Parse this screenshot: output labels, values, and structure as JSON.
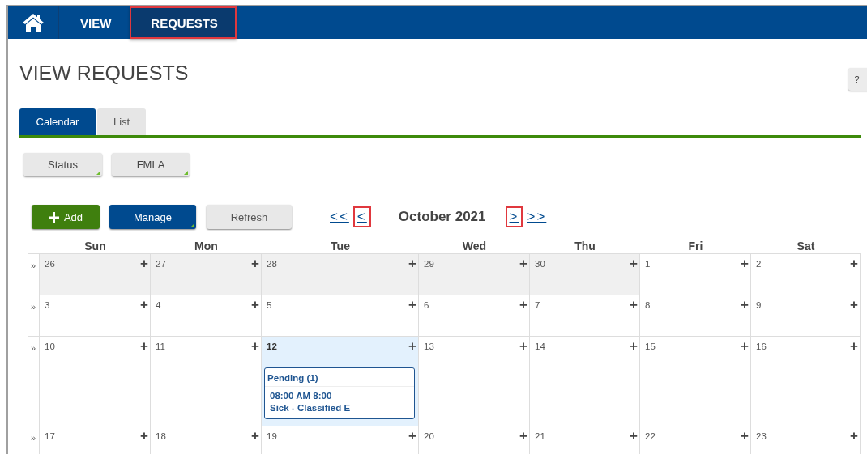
{
  "nav": {
    "items": [
      {
        "label": "VIEW",
        "selected": false,
        "highlighted": false
      },
      {
        "label": "REQUESTS",
        "selected": true,
        "highlighted": true
      }
    ]
  },
  "help": {
    "label": "?"
  },
  "page_title": "VIEW REQUESTS",
  "tabs": [
    {
      "label": "Calendar",
      "selected": true
    },
    {
      "label": "List",
      "selected": false
    }
  ],
  "filters": [
    "Status",
    "FMLA"
  ],
  "toolbar": {
    "add": "Add",
    "manage": "Manage",
    "refresh": "Refresh"
  },
  "month_nav": {
    "items": [
      {
        "label": "<<",
        "highlighted": false
      },
      {
        "label": "<",
        "highlighted": true
      },
      {
        "label": "October 2021",
        "kind": "title"
      },
      {
        "label": ">",
        "highlighted": true
      },
      {
        "label": ">>",
        "highlighted": false
      }
    ]
  },
  "calendar": {
    "expand_label": "»",
    "add_label": "+",
    "weekdays": [
      "Sun",
      "Mon",
      "Tue",
      "Wed",
      "Thu",
      "Fri",
      "Sat"
    ],
    "weeks": [
      {
        "days": [
          {
            "day": "26",
            "out_of_month": true,
            "selected": false
          },
          {
            "day": "27",
            "out_of_month": true,
            "selected": false
          },
          {
            "day": "28",
            "out_of_month": true,
            "selected": false
          },
          {
            "day": "29",
            "out_of_month": true,
            "selected": false
          },
          {
            "day": "30",
            "out_of_month": true,
            "selected": false
          },
          {
            "day": "1",
            "out_of_month": false,
            "selected": false
          },
          {
            "day": "2",
            "out_of_month": false,
            "selected": false
          }
        ]
      },
      {
        "days": [
          {
            "day": "3",
            "out_of_month": false,
            "selected": false
          },
          {
            "day": "4",
            "out_of_month": false,
            "selected": false
          },
          {
            "day": "5",
            "out_of_month": false,
            "selected": false
          },
          {
            "day": "6",
            "out_of_month": false,
            "selected": false
          },
          {
            "day": "7",
            "out_of_month": false,
            "selected": false
          },
          {
            "day": "8",
            "out_of_month": false,
            "selected": false
          },
          {
            "day": "9",
            "out_of_month": false,
            "selected": false
          }
        ]
      },
      {
        "days": [
          {
            "day": "10",
            "out_of_month": false,
            "selected": false
          },
          {
            "day": "11",
            "out_of_month": false,
            "selected": false
          },
          {
            "day": "12",
            "out_of_month": false,
            "selected": true,
            "events": [
              {
                "status": "Pending (1)",
                "time": "08:00 AM 8:00",
                "type": "Sick - Classified E"
              }
            ]
          },
          {
            "day": "13",
            "out_of_month": false,
            "selected": false
          },
          {
            "day": "14",
            "out_of_month": false,
            "selected": false
          },
          {
            "day": "15",
            "out_of_month": false,
            "selected": false
          },
          {
            "day": "16",
            "out_of_month": false,
            "selected": false
          }
        ]
      },
      {
        "days": [
          {
            "day": "17",
            "out_of_month": false,
            "selected": false
          },
          {
            "day": "18",
            "out_of_month": false,
            "selected": false
          },
          {
            "day": "19",
            "out_of_month": false,
            "selected": false
          },
          {
            "day": "20",
            "out_of_month": false,
            "selected": false
          },
          {
            "day": "21",
            "out_of_month": false,
            "selected": false
          },
          {
            "day": "22",
            "out_of_month": false,
            "selected": false
          },
          {
            "day": "23",
            "out_of_month": false,
            "selected": false
          }
        ]
      }
    ]
  }
}
